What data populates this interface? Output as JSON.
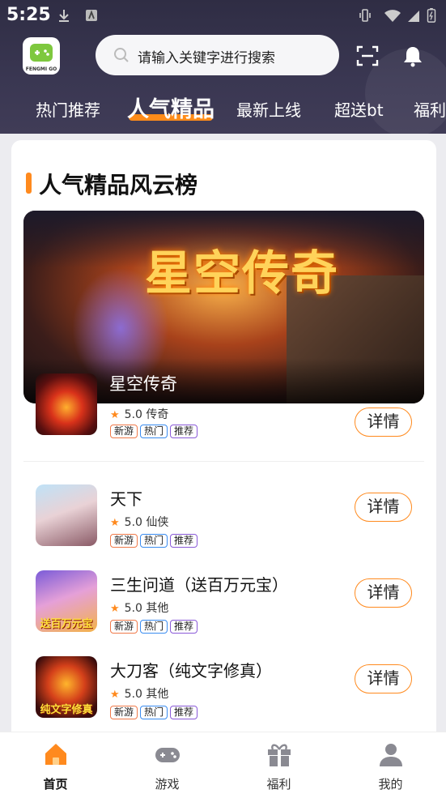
{
  "status_bar": {
    "time": "5:25"
  },
  "app": {
    "logo_text": "FENGMI GO",
    "search_placeholder": "请输入关键字进行搜索"
  },
  "tabs": [
    {
      "label": "热门推荐",
      "active": false
    },
    {
      "label": "人气精品",
      "active": true
    },
    {
      "label": "最新上线",
      "active": false
    },
    {
      "label": "超送bt",
      "active": false
    },
    {
      "label": "福利",
      "active": false
    }
  ],
  "section": {
    "title": "人气精品风云榜"
  },
  "banner": {
    "art_title": "星空传奇",
    "game_name": "星空传奇"
  },
  "games": [
    {
      "name": "星空传奇",
      "rating": "5.0",
      "category": "传奇",
      "tags": [
        "新游",
        "热门",
        "推荐"
      ],
      "detail_label": "详情",
      "icon_caption": ""
    },
    {
      "name": "天下",
      "rating": "5.0",
      "category": "仙侠",
      "tags": [
        "新游",
        "热门",
        "推荐"
      ],
      "detail_label": "详情",
      "icon_caption": ""
    },
    {
      "name": "三生问道（送百万元宝）",
      "rating": "5.0",
      "category": "其他",
      "tags": [
        "新游",
        "热门",
        "推荐"
      ],
      "detail_label": "详情",
      "icon_caption": "送百万元宝"
    },
    {
      "name": "大刀客（纯文字修真）",
      "rating": "5.0",
      "category": "其他",
      "tags": [
        "新游",
        "热门",
        "推荐"
      ],
      "detail_label": "详情",
      "icon_caption": "纯文字修真"
    }
  ],
  "bottom_nav": [
    {
      "label": "首页",
      "icon": "home-icon",
      "active": true
    },
    {
      "label": "游戏",
      "icon": "gamepad-icon",
      "active": false
    },
    {
      "label": "福利",
      "icon": "gift-icon",
      "active": false
    },
    {
      "label": "我的",
      "icon": "user-icon",
      "active": false
    }
  ],
  "colors": {
    "accent": "#ff8a1e",
    "header_bg": "#3a3752",
    "tag_new": "#f07a4a",
    "tag_hot": "#3a8cf0",
    "tag_rec": "#8a5ad8"
  }
}
